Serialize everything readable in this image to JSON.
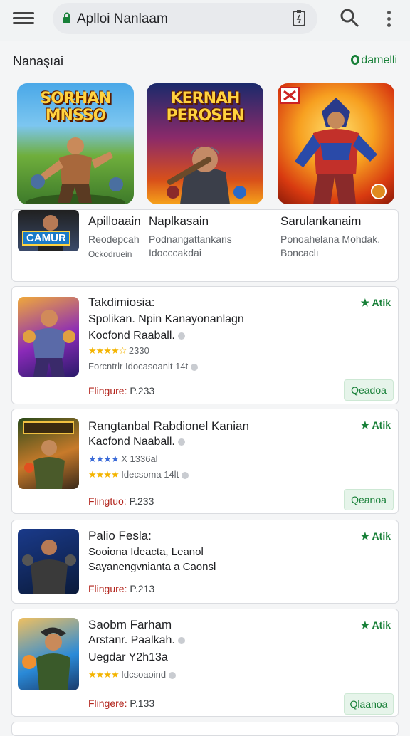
{
  "topbar": {
    "url_text": "Aplloi Nanlaam",
    "icons": [
      "menu-icon",
      "lock-icon",
      "document-icon",
      "search-icon",
      "more-vert-icon"
    ]
  },
  "section": {
    "title": "Nanaşıai",
    "more": "damelli"
  },
  "featured": [
    {
      "label": "SORHAN MNSSO"
    },
    {
      "label": "KERNAH PEROSEN"
    },
    {
      "label": ""
    }
  ],
  "info_card": {
    "thumb_badge": "CAMUR",
    "col1": {
      "title": "Apilloaain",
      "sub": "Reodepcah",
      "sub2": "Ockodruein"
    },
    "col2": {
      "title": "Naplkasain",
      "line1": "Podnangattankaris",
      "line2": "Idocccakdai"
    },
    "col3": {
      "title": "Sarulankanaim",
      "line1": "Ponoahelana Mohdak.",
      "line2": "Boncaclı"
    }
  },
  "apps": [
    {
      "title": "Takdimiosia:",
      "line1": "Spolikan. Npin Kanayonanlagn",
      "line2": "Kocfond Raaball.",
      "rating_text": "2330",
      "meta": "Forcntrlr Idocasoanit 14t",
      "price_label": "Flingure:",
      "price_value": "P.233",
      "badge": "★ Atik",
      "button": "Qeadoa"
    },
    {
      "title": "Rangtanbal Rabdionel Kanian",
      "line1": "Kacfond Naaball.",
      "rating_text": "X 1336al",
      "meta": "Idecsoma 14lt",
      "price_label": "Flingtuo:",
      "price_value": "P.233",
      "badge": "★ Atik",
      "button": "Qeanoa"
    },
    {
      "title": "Palio Fesla:",
      "line1": "Sooiona Ideacta,  Leanol",
      "line2": "Sayanengvnianta a Caonsl",
      "price_label": "Flingure:",
      "price_value": "P.213",
      "badge": "★ Atik"
    },
    {
      "title": "Saobm Farham",
      "line1": "Arstanr. Paalkah.",
      "line2": "Uegdar  Y2h13a",
      "meta": "Idcsoaoind",
      "price_label": "Flingere:",
      "price_value": "P.133",
      "badge": "★ Atik",
      "button": "Qlaanoa"
    }
  ]
}
